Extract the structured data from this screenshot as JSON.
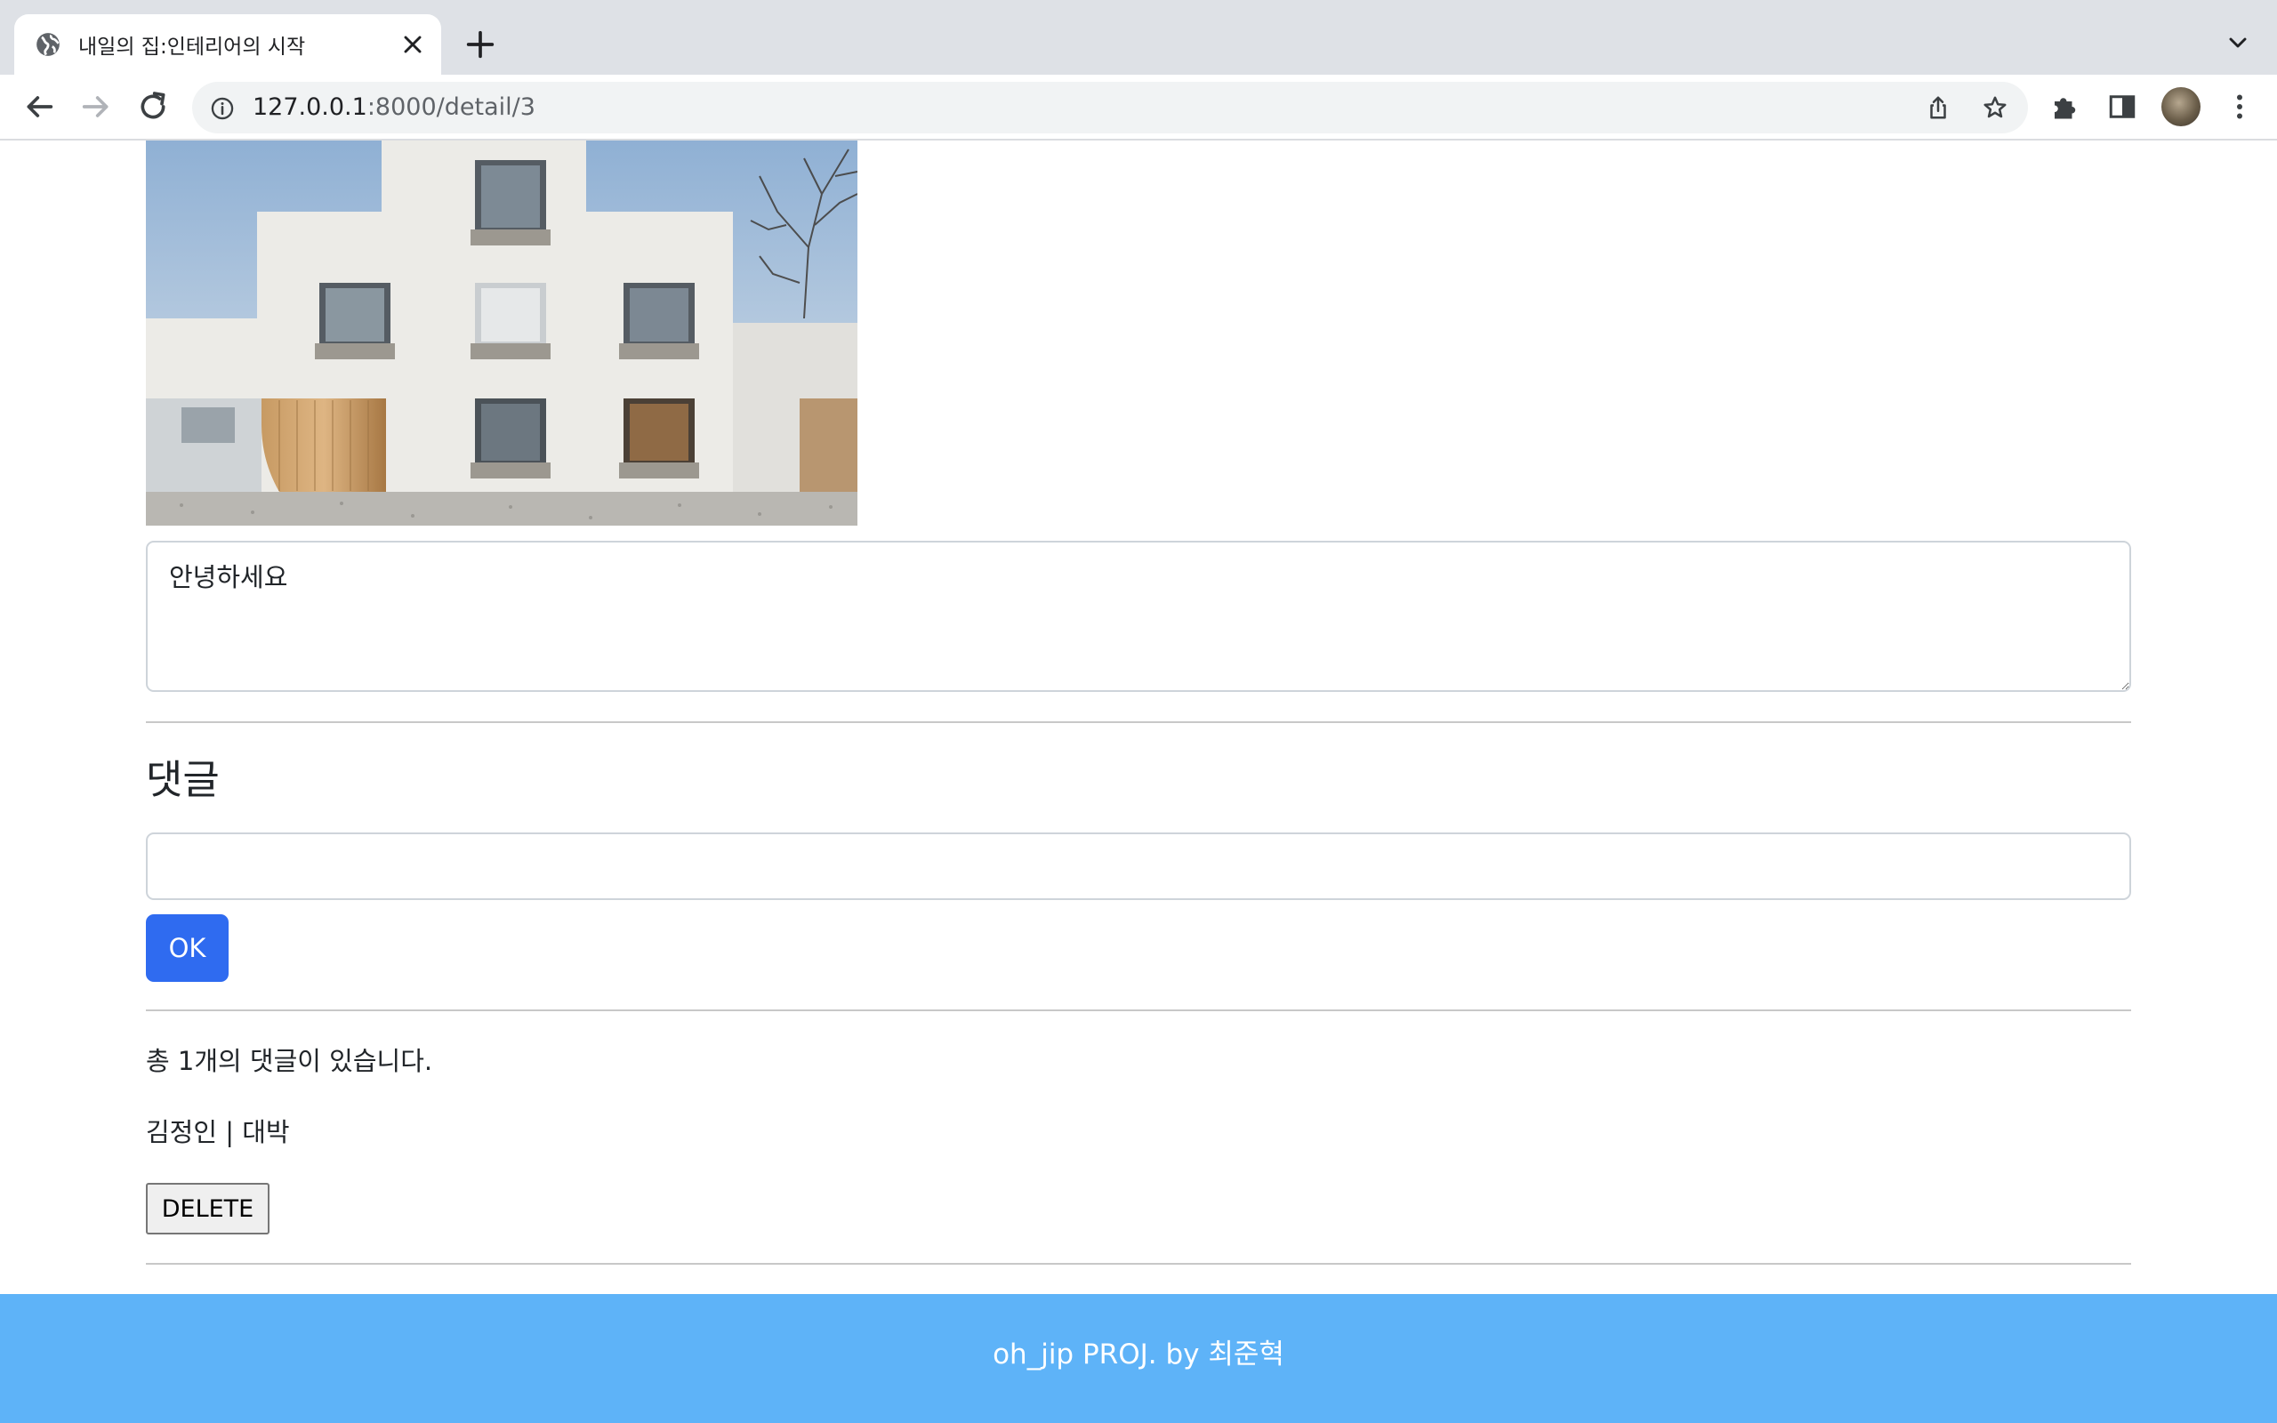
{
  "browser": {
    "tab_title": "내일의 집:인테리어의 시작",
    "url_host": "127.0.0.1",
    "url_rest": ":8000/detail/3"
  },
  "post": {
    "image_alt": "white modern house facade",
    "body_text": "안녕하세요"
  },
  "comments": {
    "heading": "댓글",
    "input_value": "",
    "submit_label": "OK",
    "count_text": "총 1개의 댓글이 있습니다.",
    "items": [
      {
        "text": "김정인 | 대박",
        "delete_label": "DELETE"
      }
    ]
  },
  "footer": {
    "text": "oh_jip PROJ. by 최준혁"
  },
  "colors": {
    "primary_button": "#2f6bf0",
    "footer_bg": "#5eb3f8"
  }
}
